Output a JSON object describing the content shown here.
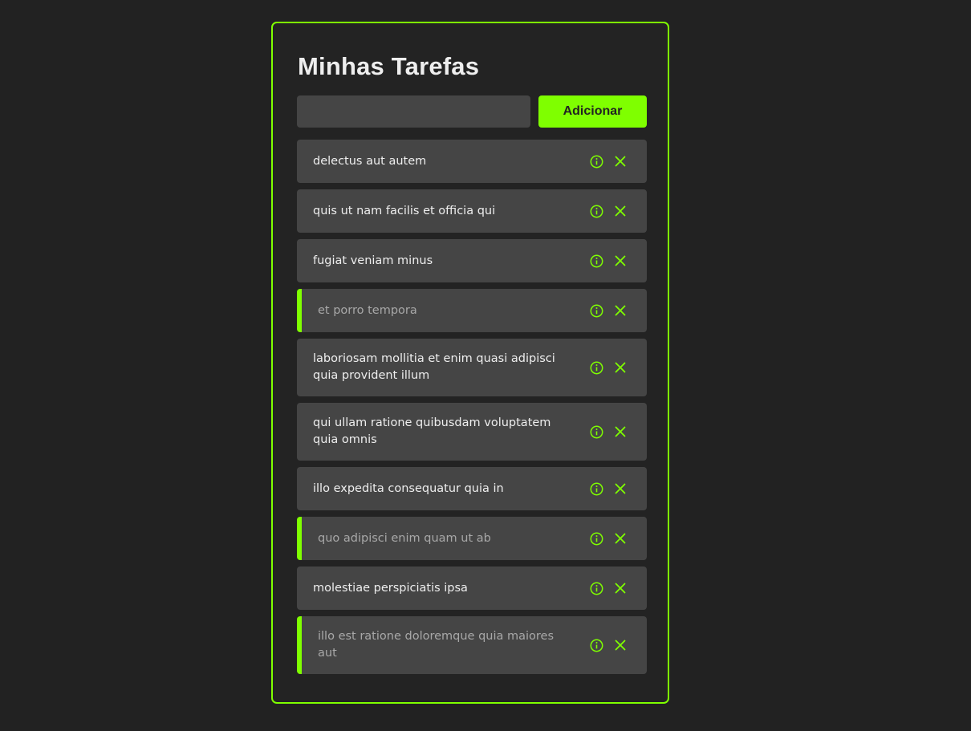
{
  "app": {
    "title": "Minhas Tarefas"
  },
  "form": {
    "input_value": "",
    "input_placeholder": "",
    "add_label": "Adicionar"
  },
  "colors": {
    "accent": "#7fff00",
    "background": "#222222",
    "item_background": "#454545",
    "text": "#eeeeee",
    "done_text": "#a8a8a8"
  },
  "tasks": [
    {
      "text": "delectus aut autem",
      "completed": false,
      "info_icon": "info-icon",
      "delete_icon": "close-icon"
    },
    {
      "text": "quis ut nam facilis et officia qui",
      "completed": false,
      "info_icon": "info-icon",
      "delete_icon": "close-icon"
    },
    {
      "text": "fugiat veniam minus",
      "completed": false,
      "info_icon": "info-icon",
      "delete_icon": "close-icon"
    },
    {
      "text": "et porro tempora",
      "completed": true,
      "info_icon": "info-icon",
      "delete_icon": "close-icon"
    },
    {
      "text": "laboriosam mollitia et enim quasi adipisci quia provident illum",
      "completed": false,
      "info_icon": "info-icon",
      "delete_icon": "close-icon"
    },
    {
      "text": "qui ullam ratione quibusdam voluptatem quia omnis",
      "completed": false,
      "info_icon": "info-icon",
      "delete_icon": "close-icon"
    },
    {
      "text": "illo expedita consequatur quia in",
      "completed": false,
      "info_icon": "info-icon",
      "delete_icon": "close-icon"
    },
    {
      "text": "quo adipisci enim quam ut ab",
      "completed": true,
      "info_icon": "info-icon",
      "delete_icon": "close-icon"
    },
    {
      "text": "molestiae perspiciatis ipsa",
      "completed": false,
      "info_icon": "info-icon",
      "delete_icon": "close-icon"
    },
    {
      "text": "illo est ratione doloremque quia maiores aut",
      "completed": true,
      "info_icon": "info-icon",
      "delete_icon": "close-icon"
    }
  ]
}
